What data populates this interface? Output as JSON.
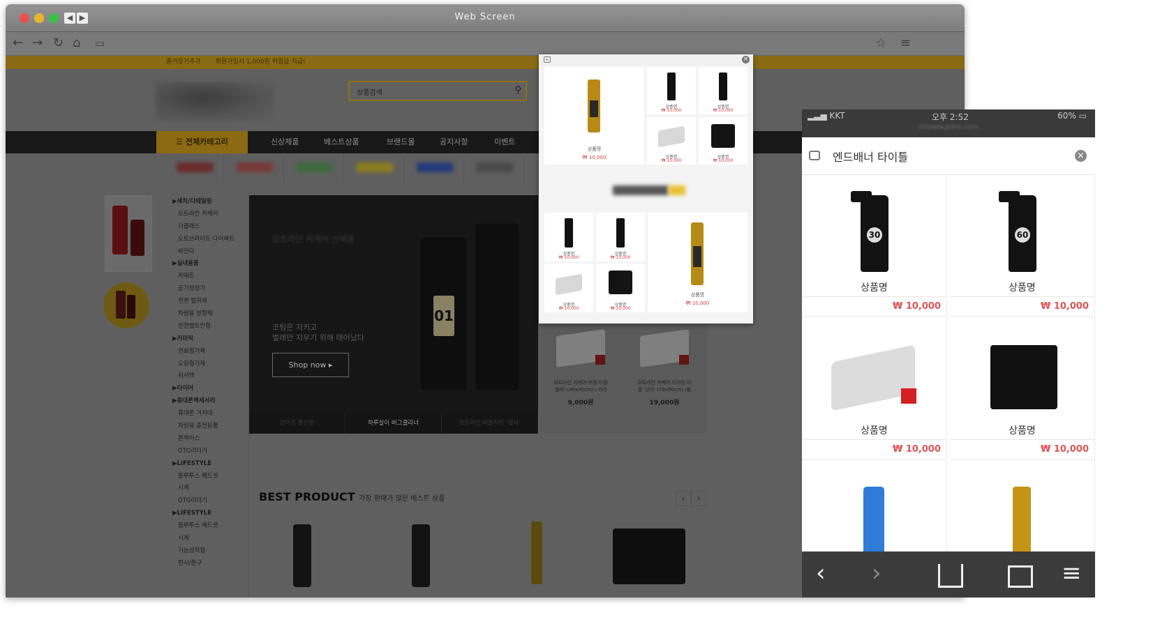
{
  "window": {
    "title": "Web Screen"
  },
  "topbar": {
    "links": [
      "즐겨찾기추가",
      "회원가입시 1,000원 적립금 지급!"
    ]
  },
  "search": {
    "placeholder": "상품검색"
  },
  "gnb": {
    "category_label": "☰ 전체카테고리",
    "items": [
      "신상제품",
      "베스트상품",
      "브랜드몰",
      "공지사항",
      "이벤트"
    ]
  },
  "categories": [
    {
      "label": "▶세차/디테일링",
      "head": true
    },
    {
      "label": "모트라인 카케어"
    },
    {
      "label": "더클래스"
    },
    {
      "label": "오토브라이트 다이렉트"
    },
    {
      "label": "바인더"
    },
    {
      "label": "▶실내용품",
      "head": true
    },
    {
      "label": "카매트"
    },
    {
      "label": "공기청정기"
    },
    {
      "label": "전면 탈취제"
    },
    {
      "label": "차량용 방향제"
    },
    {
      "label": "안전벨트인형"
    },
    {
      "label": "▶카미릭",
      "head": true
    },
    {
      "label": "연료첨가제"
    },
    {
      "label": "오일첨가제"
    },
    {
      "label": "워셔액"
    },
    {
      "label": "▶타이어",
      "head": true
    },
    {
      "label": "▶휴대폰액세서리",
      "head": true
    },
    {
      "label": "휴대폰 거치대"
    },
    {
      "label": "차량용 충전용품"
    },
    {
      "label": "폰케이스"
    },
    {
      "label": "OTG리더기"
    },
    {
      "label": "▶LIFESTYLE",
      "head": true
    },
    {
      "label": "블루투스 헤드셋"
    },
    {
      "label": "시계"
    },
    {
      "label": "OTG리더기"
    },
    {
      "label": "▶LIFESTYLE",
      "head": true
    },
    {
      "label": "블루투스 헤드셋"
    },
    {
      "label": "시계"
    },
    {
      "label": "기능성작업"
    },
    {
      "label": "편시/문구"
    }
  ],
  "banner": {
    "title": "모트라인 카케어 신제품",
    "subtitle_1": "코팅은 지키고",
    "subtitle_2": "벌레만 지우기 위해 태어났다",
    "cta": "Shop now ▸",
    "tabs": [
      "강아조 통민원",
      "하루살이 버그클리너",
      "모트라인 버블차트 '할라'"
    ]
  },
  "side_products": [
    {
      "name": "모트라인 카케어 버핑 타월 '블라' (40x40cm) / 라무",
      "price": "9,000원"
    },
    {
      "name": "모트라인 카케어 드라잉 타월 '당이' (70x90cm) /블",
      "price": "19,000원"
    }
  ],
  "best": {
    "title": "BEST PRODUCT",
    "subtitle": "가장 판매가 많은 베스트 상품",
    "prev": "‹",
    "next": "›"
  },
  "popup": {
    "item_name": "상품명",
    "item_price": "₩ 10,000",
    "close": "×"
  },
  "phone": {
    "carrier": "KKT",
    "time": "오후 2:52",
    "battery": "60%",
    "url": "mteww.jolns.com",
    "banner_title": "엔드배너 타이틀",
    "products": [
      {
        "name": "상품명",
        "price": "₩ 10,000",
        "kind": "spray",
        "label": "30"
      },
      {
        "name": "상품명",
        "price": "₩ 10,000",
        "kind": "spray",
        "label": "60"
      },
      {
        "name": "상품명",
        "price": "₩ 10,000",
        "kind": "towel-grey"
      },
      {
        "name": "상품명",
        "price": "₩ 10,000",
        "kind": "towel-black"
      },
      {
        "name": "",
        "price": "",
        "kind": "blue-bottle"
      },
      {
        "name": "",
        "price": "",
        "kind": "gold-bottle"
      }
    ],
    "nav": [
      "‹",
      "›",
      "share",
      "tabs",
      "≡"
    ]
  },
  "colors": {
    "accent": "#f2c32a",
    "price_red": "#e05555",
    "gnb": "#181818"
  }
}
